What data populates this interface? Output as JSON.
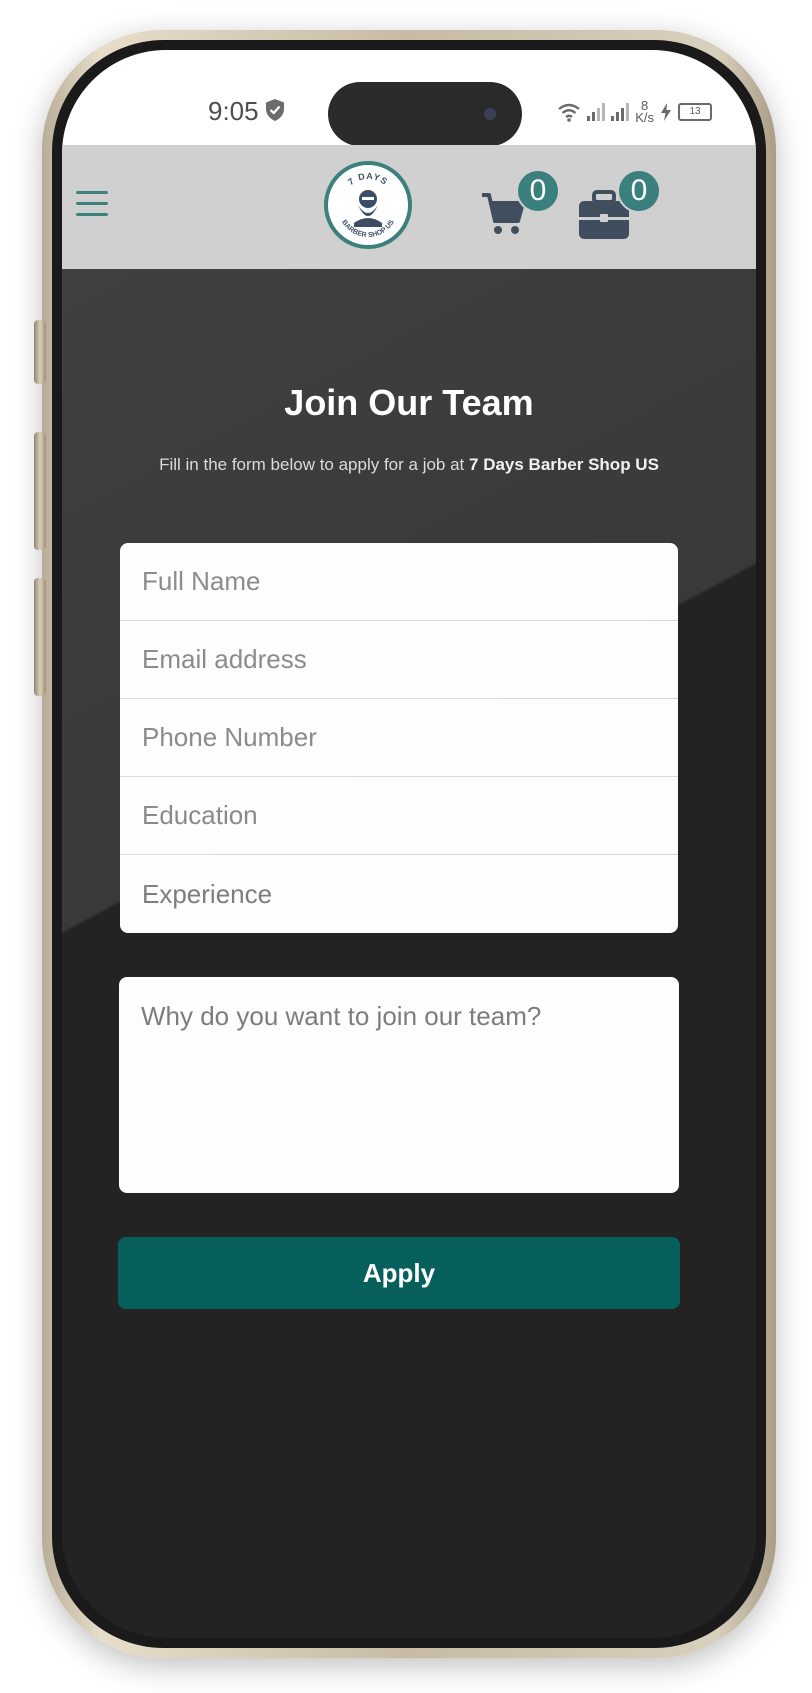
{
  "status_bar": {
    "time": "9:05",
    "net_speed_value": "8",
    "net_speed_unit": "K/s",
    "battery": "13"
  },
  "header": {
    "logo": {
      "top_text": "7 DAYS",
      "bottom_text": "BARBER SHOP US"
    },
    "cart_count": "0",
    "jobs_count": "0"
  },
  "page": {
    "title": "Join Our Team",
    "subtitle_prefix": "Fill in the form below to apply for a job at ",
    "subtitle_brand": "7 Days Barber Shop US"
  },
  "form": {
    "full_name_placeholder": "Full Name",
    "email_placeholder": "Email address",
    "phone_placeholder": "Phone Number",
    "education_placeholder": "Education",
    "experience_placeholder": "Experience",
    "reason_placeholder": "Why do you want to join our team?",
    "apply_label": "Apply"
  },
  "colors": {
    "accent": "#075f5c",
    "header_bg": "#c9c9c9",
    "page_bg": "#232323"
  }
}
